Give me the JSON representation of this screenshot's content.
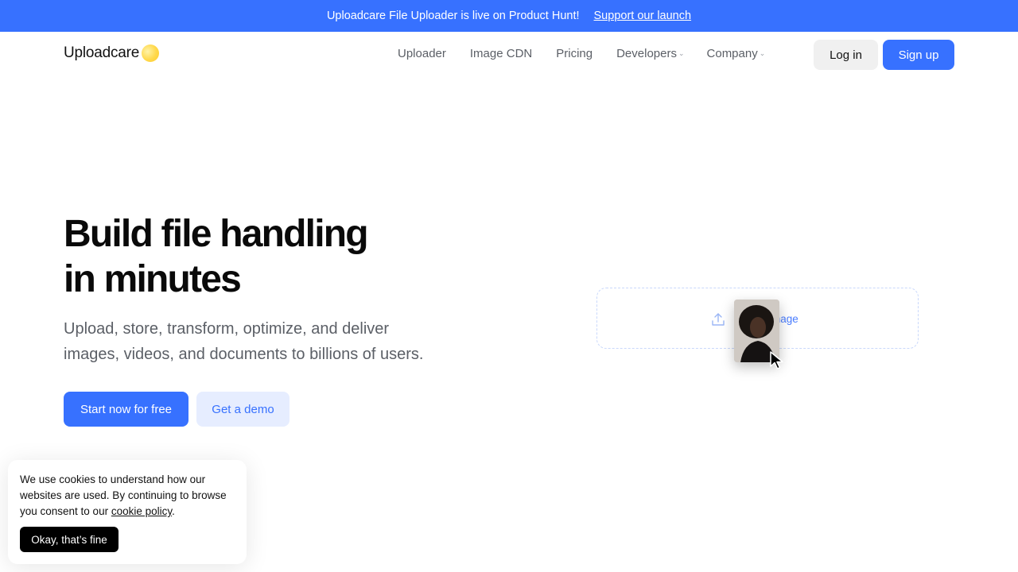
{
  "banner": {
    "text": "Uploadcare File Uploader is live on Product Hunt!",
    "link": "Support our launch"
  },
  "header": {
    "logo_text": "Uploadcare",
    "nav": [
      {
        "label": "Uploader"
      },
      {
        "label": "Image CDN"
      },
      {
        "label": "Pricing"
      },
      {
        "label": "Developers",
        "dropdown": true
      },
      {
        "label": "Company",
        "dropdown": true
      }
    ],
    "login_label": "Log in",
    "signup_label": "Sign up"
  },
  "hero": {
    "title_line1": "Build file handling",
    "title_line2": "in minutes",
    "subtitle_line1": "Upload, store, transform, optimize, and deliver",
    "subtitle_line2": "images, videos, and documents to billions of users.",
    "primary_cta": "Start now for free",
    "secondary_cta": "Get a demo"
  },
  "demo": {
    "dropzone_text": "mage"
  },
  "cookie": {
    "text": "We use cookies to understand how our websites are used. By continuing to browse you consent to our ",
    "link": "cookie policy",
    "end": ".",
    "button": "Okay, that’s fine"
  },
  "colors": {
    "accent": "#3771ff",
    "accent_light": "#e6edff",
    "text_muted": "#5b5f66"
  }
}
